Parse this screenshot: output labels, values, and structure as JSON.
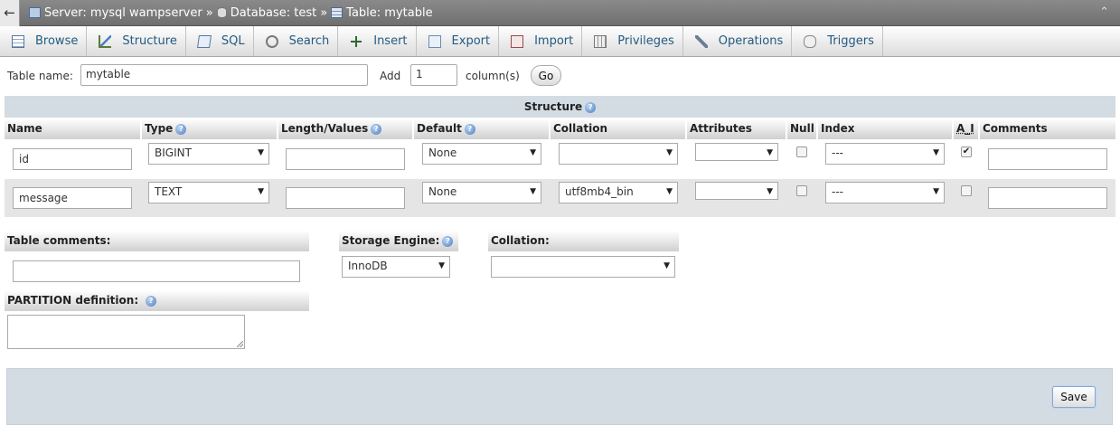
{
  "breadcrumb": {
    "back": "←",
    "server": "Server: mysql wampserver",
    "database": "Database: test",
    "table": "Table: mytable",
    "sep": "»",
    "collapse": "⌃"
  },
  "tabs": [
    {
      "label": "Browse"
    },
    {
      "label": "Structure"
    },
    {
      "label": "SQL"
    },
    {
      "label": "Search"
    },
    {
      "label": "Insert"
    },
    {
      "label": "Export"
    },
    {
      "label": "Import"
    },
    {
      "label": "Privileges"
    },
    {
      "label": "Operations"
    },
    {
      "label": "Triggers"
    }
  ],
  "tablebar": {
    "name_label": "Table name:",
    "name_value": "mytable",
    "add_label": "Add",
    "add_value": "1",
    "columns_label": "column(s)",
    "go_label": "Go"
  },
  "structure": {
    "title": "Structure",
    "help": "?",
    "headers": {
      "name": "Name",
      "type": "Type",
      "length": "Length/Values",
      "default": "Default",
      "collation": "Collation",
      "attributes": "Attributes",
      "null": "Null",
      "index": "Index",
      "ai": "A_I",
      "comments": "Comments"
    },
    "rows": [
      {
        "name": "id",
        "type": "BIGINT",
        "length": "",
        "default": "None",
        "collation": "",
        "attributes": "",
        "null": false,
        "index": "---",
        "ai": true,
        "comments": ""
      },
      {
        "name": "message",
        "type": "TEXT",
        "length": "",
        "default": "None",
        "collation": "utf8mb4_bin",
        "attributes": "",
        "null": false,
        "index": "---",
        "ai": false,
        "comments": ""
      }
    ]
  },
  "bottom": {
    "table_comments_label": "Table comments:",
    "table_comments_value": "",
    "storage_engine_label": "Storage Engine:",
    "storage_engine_value": "InnoDB",
    "collation_label": "Collation:",
    "collation_value": "",
    "partition_label": "PARTITION definition:",
    "save_label": "Save"
  },
  "colors": {
    "topbar": "#7c7c7c",
    "link": "#235a81",
    "section_bg": "#d3dce3",
    "row_alt": "#e5e5e5"
  }
}
